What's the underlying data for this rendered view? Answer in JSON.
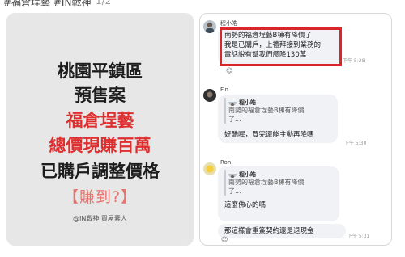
{
  "header": {
    "title": "#福倉埕藝 #IN戰神",
    "count": "1/2"
  },
  "poster": {
    "line1": "桃園平鎮區",
    "line2": "預售案",
    "line3": "福倉埕藝",
    "line4": "總價現賺百萬",
    "line5": "已購戶調整價格",
    "line6": "【賺到?】",
    "credit": "@IN戰神 買屋素人",
    "colors": {
      "accent_red": "#df2e2e",
      "soft_red": "#e5736e",
      "card_bg": "#e7e7e7"
    }
  },
  "comments": [
    {
      "author": "程小皓",
      "lines": [
        "南勢的福倉埕藝B棟有降價了",
        "我是已購戶，上禮拜接到業務的",
        "電話說有幫我們調降130萬"
      ],
      "time": "下午 5:28",
      "highlighted": true
    },
    {
      "author": "Fin",
      "quote_author": "程小皓",
      "quote_lines": [
        "南勢的福倉埕藝B棟有降價",
        "了..."
      ],
      "reply": "好酷喔，買完還能主動再降嗎",
      "time": "下午 5:30"
    },
    {
      "author": "Ron",
      "quote_author": "程小皓",
      "quote_lines": [
        "南勢的福倉埕藝B棟有降價",
        "了..."
      ],
      "reply": "這麼佛心的嗎",
      "reply2": "那這樣會重簽契約還是退現金",
      "time": "下午 5:31"
    }
  ],
  "icons": {
    "reaction": "smiley-reaction-icon"
  }
}
